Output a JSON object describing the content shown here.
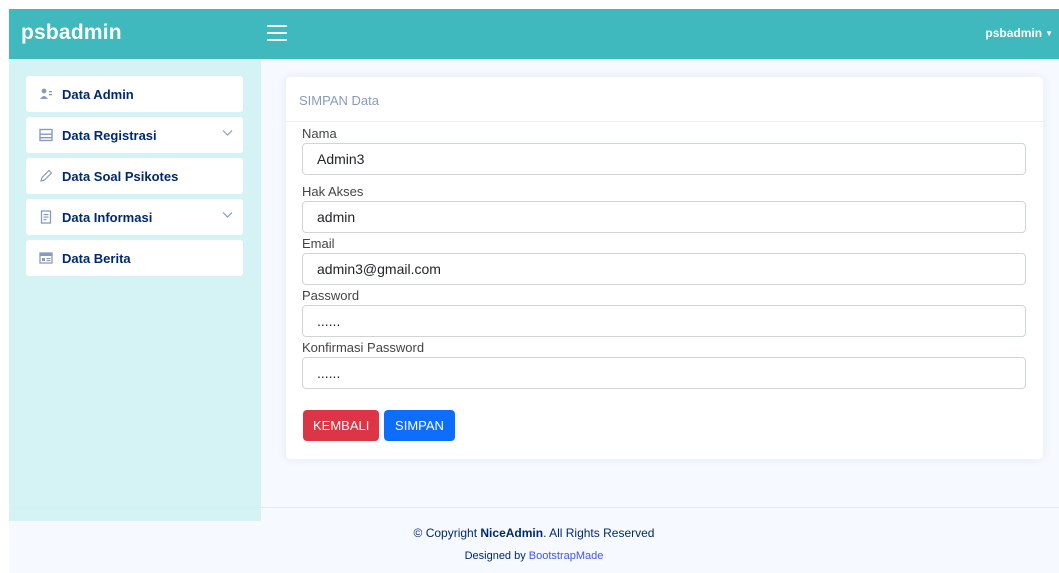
{
  "header": {
    "brand": "psbadmin",
    "user": "psbadmin"
  },
  "sidebar": {
    "items": [
      {
        "label": "Data Admin",
        "icon": "users-icon",
        "has_chevron": false
      },
      {
        "label": "Data Registrasi",
        "icon": "layout-icon",
        "has_chevron": true
      },
      {
        "label": "Data Soal Psikotes",
        "icon": "pencil-icon",
        "has_chevron": false
      },
      {
        "label": "Data Informasi",
        "icon": "document-icon",
        "has_chevron": true
      },
      {
        "label": "Data Berita",
        "icon": "newspaper-icon",
        "has_chevron": false
      }
    ]
  },
  "form": {
    "title": "SIMPAN Data",
    "fields": [
      {
        "label": "Nama",
        "value": "Admin3"
      },
      {
        "label": "Hak Akses",
        "value": "admin"
      },
      {
        "label": "Email",
        "value": "admin3@gmail.com"
      },
      {
        "label": "Password",
        "value": "......"
      },
      {
        "label": "Konfirmasi Password",
        "value": "......"
      }
    ],
    "back_button": "KEMBALI",
    "save_button": "SIMPAN"
  },
  "footer": {
    "copyright_prefix": "© Copyright ",
    "copyright_brand": "NiceAdmin",
    "copyright_suffix": ". All Rights Reserved",
    "designed_by": "Designed by ",
    "designer": "BootstrapMade"
  },
  "colors": {
    "header": "#3fb8be",
    "sidebar": "#d5f2f4",
    "nav_text": "#012970",
    "danger": "#dc3545",
    "primary": "#0d6efd"
  }
}
